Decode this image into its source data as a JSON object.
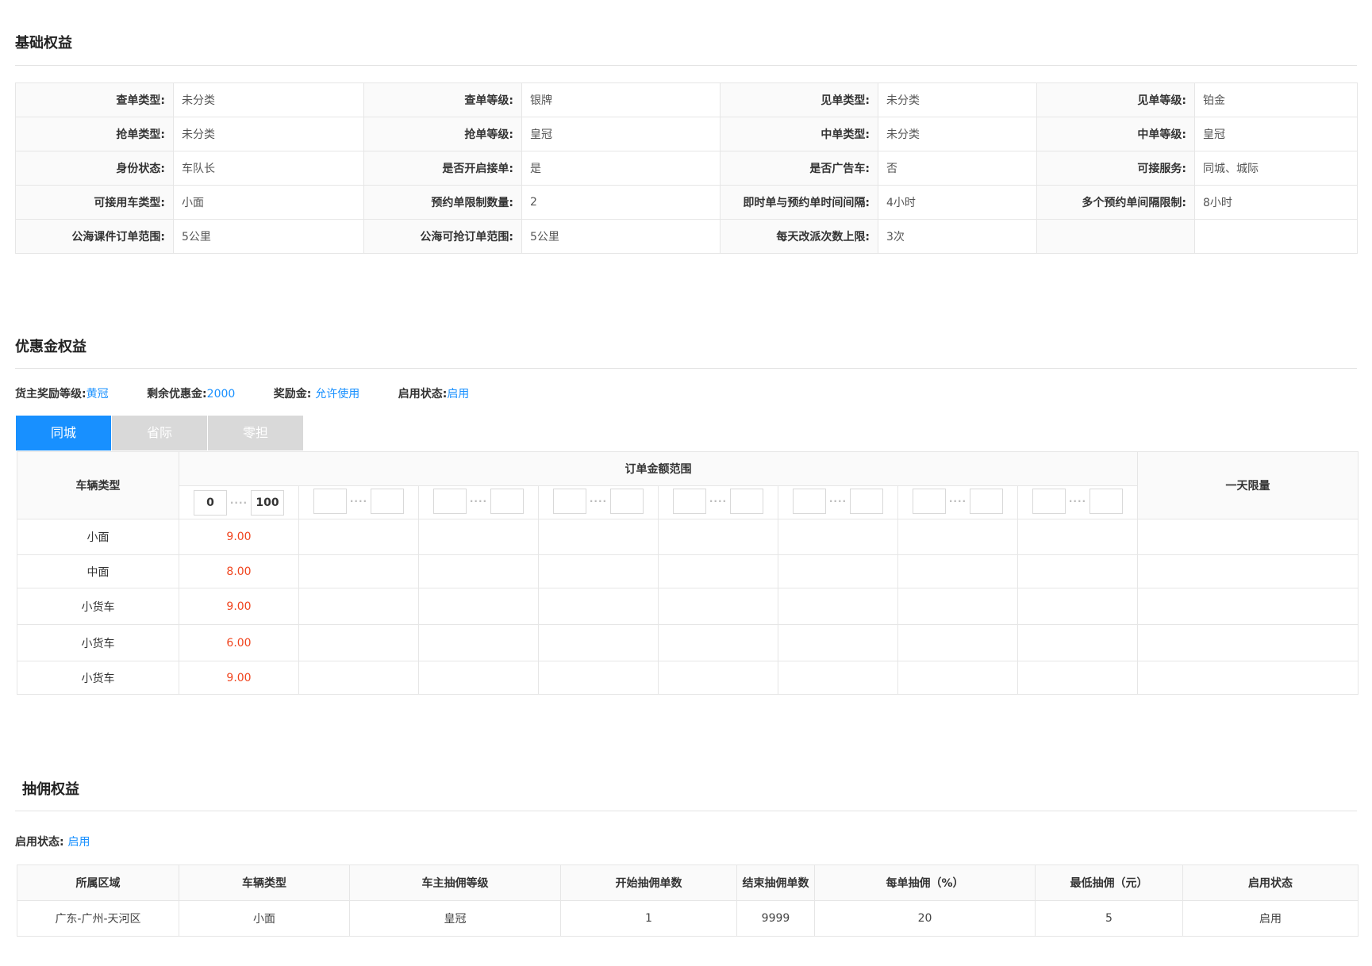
{
  "basic": {
    "title": "基础权益",
    "rows": [
      [
        [
          "查单类型:",
          "未分类"
        ],
        [
          "查单等级:",
          "银牌"
        ],
        [
          "见单类型:",
          "未分类"
        ],
        [
          "见单等级:",
          "铂金"
        ]
      ],
      [
        [
          "抢单类型:",
          "未分类"
        ],
        [
          "抢单等级:",
          "皇冠"
        ],
        [
          "中单类型:",
          "未分类"
        ],
        [
          "中单等级:",
          "皇冠"
        ]
      ],
      [
        [
          "身份状态:",
          "车队长"
        ],
        [
          "是否开启接单:",
          "是"
        ],
        [
          "是否广告车:",
          "否"
        ],
        [
          "可接服务:",
          "同城、城际"
        ]
      ],
      [
        [
          "可接用车类型:",
          "小面"
        ],
        [
          "预约单限制数量:",
          "2"
        ],
        [
          "即时单与预约单时间间隔:",
          "4小时"
        ],
        [
          "多个预约单间隔限制:",
          "8小时"
        ]
      ],
      [
        [
          "公海课件订单范围:",
          "5公里"
        ],
        [
          "公海可抢订单范围:",
          "5公里"
        ],
        [
          "每天改派次数上限:",
          "3次"
        ],
        [
          "",
          ""
        ]
      ]
    ]
  },
  "coupon": {
    "title": "优惠金权益",
    "info": [
      {
        "label": "货主奖励等级:",
        "value": "黄冠"
      },
      {
        "label": "剩余优惠金:",
        "value": "2000"
      },
      {
        "label": "奖励金:",
        "value": "允许使用"
      },
      {
        "label": "启用状态:",
        "value": "启用"
      }
    ],
    "tabs": [
      "同城",
      "省际",
      "零担"
    ],
    "active_tab": 0,
    "headers": {
      "vehicle": "车辆类型",
      "range": "订单金额范围",
      "limit": "一天限量"
    },
    "ranges": [
      [
        "0",
        "100"
      ],
      [
        "",
        ""
      ],
      [
        "",
        ""
      ],
      [
        "",
        ""
      ],
      [
        "",
        ""
      ],
      [
        "",
        ""
      ],
      [
        "",
        ""
      ],
      [
        "",
        ""
      ]
    ],
    "range_sep": "····",
    "rows": [
      {
        "vehicle": "小面",
        "price": "9.00"
      },
      {
        "vehicle": "中面",
        "price": "8.00"
      },
      {
        "vehicle": "小货车",
        "price": "9.00"
      },
      {
        "vehicle": "小货车",
        "price": "6.00"
      },
      {
        "vehicle": "小货车",
        "price": "9.00"
      }
    ],
    "price_color": "#f0441e"
  },
  "commission": {
    "title": "抽佣权益",
    "status_label": "启用状态:",
    "status_value": "启用",
    "headers": [
      "所属区域",
      "车辆类型",
      "车主抽佣等级",
      "开始抽佣单数",
      "结束抽佣单数",
      "每单抽佣（%）",
      "最低抽佣（元）",
      "启用状态"
    ],
    "rows": [
      [
        "广东-广州-天河区",
        "小面",
        "皇冠",
        "1",
        "9999",
        "20",
        "5",
        "启用"
      ]
    ]
  },
  "colors": {
    "accent": "#1890ff",
    "tab_inactive": "#d9d9d9"
  }
}
